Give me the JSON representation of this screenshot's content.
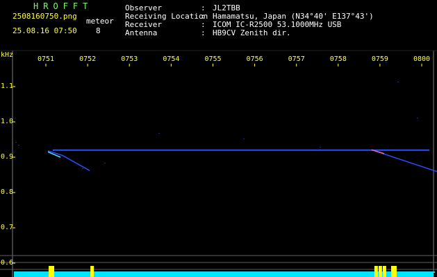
{
  "app": {
    "brand": "HROFFT",
    "file_name": "2508160750.png",
    "datetime": "25.08.16 07:50",
    "meteor_label": "meteor",
    "meteor_count": "8"
  },
  "station": [
    {
      "key": "Observer",
      "value": "JL2TBB"
    },
    {
      "key": "Receiving Location",
      "value": "Hamamatsu, Japan (N34°40' E137°43')"
    },
    {
      "key": "Receiver",
      "value": "ICOM IC-R2500 53.1000MHz USB"
    },
    {
      "key": "Antenna",
      "value": "HB9CV Zenith dir."
    }
  ],
  "colors": {
    "text_header": "#ffffff",
    "text_accent": "#7cfc6a",
    "axis_label": "#ffff40",
    "trace": "#2a50ff",
    "level": "#00e5ff",
    "level_peak": "#ffff00",
    "background": "#000000"
  },
  "chart_data": {
    "type": "heatmap",
    "ylabel": "kHz",
    "y_ticks": [
      "1.1",
      "1.0",
      "0.9",
      "0.8",
      "0.7",
      "0.6"
    ],
    "ylim": [
      0.56,
      1.16
    ],
    "x_ticks": [
      "0751",
      "0752",
      "0753",
      "0754",
      "0755",
      "0756",
      "0757",
      "0758",
      "0759",
      "0800"
    ],
    "xlim_minutes": [
      0,
      10
    ],
    "carrier_khz": 0.92,
    "traces": [
      {
        "t": [
          0.05,
          0.4,
          1.05
        ],
        "f": [
          0.918,
          0.905,
          0.862
        ]
      },
      {
        "t": [
          7.8,
          8.2,
          9.4
        ],
        "f": [
          0.921,
          0.905,
          0.858
        ]
      }
    ],
    "level_spikes_minutes": [
      0.1,
      0.15,
      1.1,
      7.9,
      8.0,
      8.1,
      8.3,
      8.35
    ]
  }
}
